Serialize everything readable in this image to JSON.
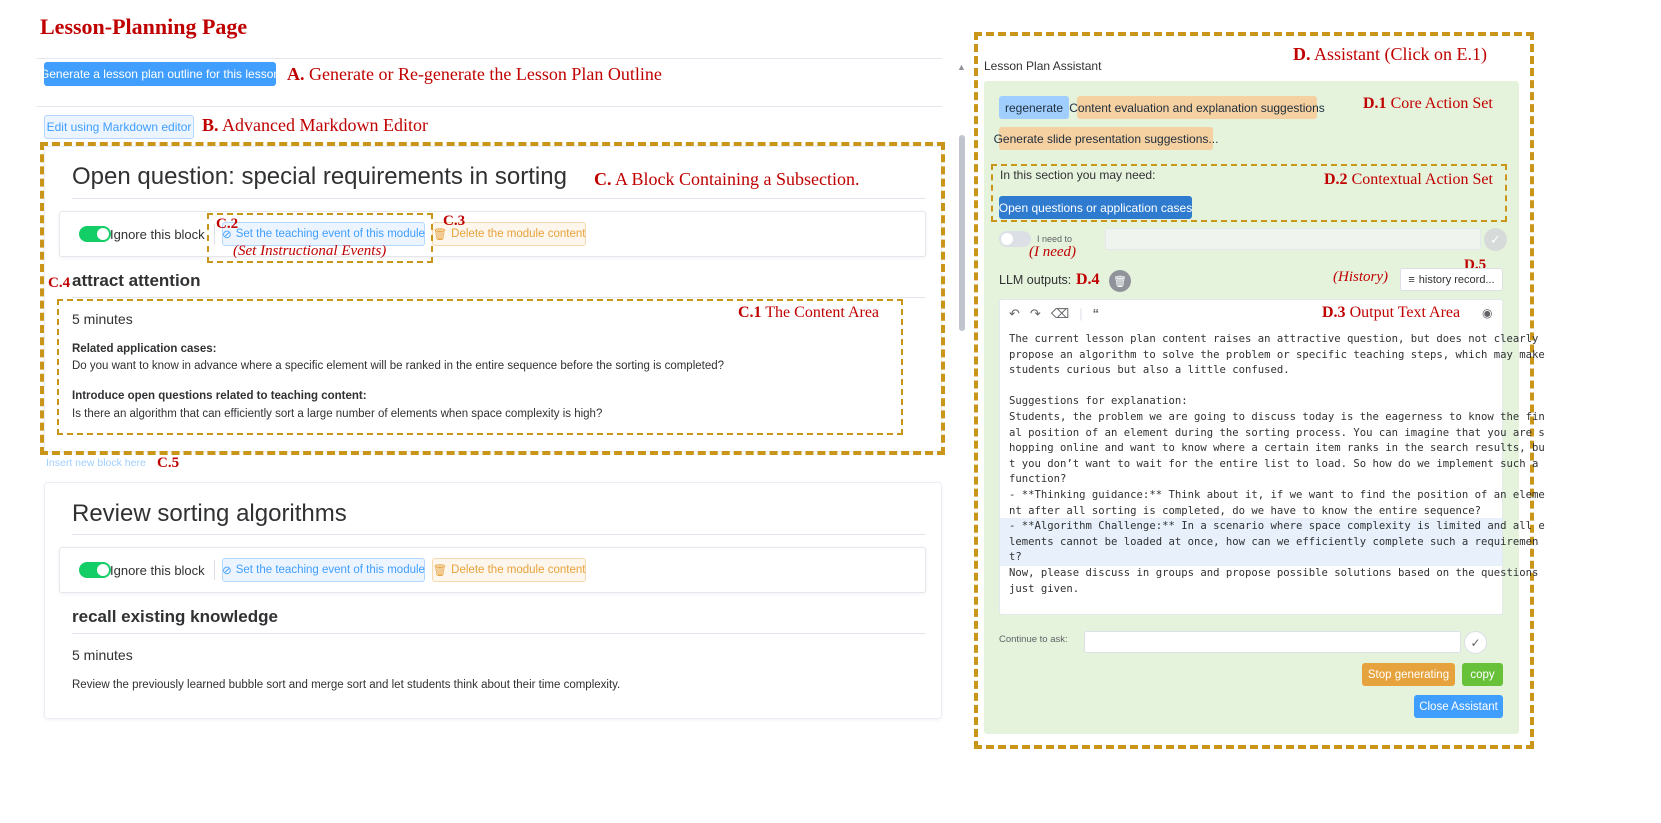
{
  "page_title": "Lesson-Planning Page",
  "colors": {
    "accent": "#409eff",
    "success": "#13ce66",
    "warning": "#e6a23c",
    "annotation": "#c00000",
    "frame": "#c9961a",
    "assistant_bg": "#e5f3dd"
  },
  "annotations": {
    "a_letter": "A.",
    "a_text": "Generate or Re-generate the Lesson Plan Outline",
    "b_letter": "B.",
    "b_text": "Advanced Markdown Editor",
    "c_letter": "C.",
    "c_text": "A Block Containing a Subsection.",
    "c1_letter": "C.1",
    "c1_text": "The Content Area",
    "c2": "C.2",
    "c2_sub": "(Set Instructional Events)",
    "c3": "C.3",
    "c4": "C.4",
    "c5": "C.5",
    "d_letter": "D.",
    "d_text": "Assistant (Click on E.1)",
    "d1_letter": "D.1",
    "d1_text": "Core Action Set",
    "d2_letter": "D.2",
    "d2_text": "Contextual Action Set",
    "d3_letter": "D.3",
    "d3_text": "Output Text Area",
    "d4": "D.4",
    "d5": "D.5",
    "i_need": "(I need)",
    "history": "(History)"
  },
  "toolbar": {
    "generate_outline_label": "Generate a lesson plan outline for this lesson",
    "markdown_editor_label": "Edit using Markdown editor"
  },
  "blocks": [
    {
      "title": "Open question: special requirements in sorting",
      "ignore_label": "Ignore this block",
      "ignore_on": true,
      "set_event_label": "Set the teaching event of this module",
      "delete_label": "Delete the module content",
      "event_heading": "attract attention",
      "duration": "5 minutes",
      "sections": [
        {
          "heading": "Related application cases:",
          "text": "Do you want to know in advance where a specific element will be ranked in the entire sequence before the sorting is completed?"
        },
        {
          "heading": "Introduce open questions related to teaching content:",
          "text": "Is there an algorithm that can efficiently sort a large number of elements when space complexity is high?"
        }
      ]
    },
    {
      "title": "Review sorting algorithms",
      "ignore_label": "Ignore this block",
      "ignore_on": true,
      "set_event_label": "Set the teaching event of this module",
      "delete_label": "Delete the module content",
      "event_heading": "recall existing knowledge",
      "duration": "5 minutes",
      "text": "Review the previously learned bubble sort and merge sort and let students think about their time complexity."
    }
  ],
  "insert_block_label": "Insert new block here",
  "assistant": {
    "title": "Lesson Plan Assistant",
    "core_actions": [
      "regenerate",
      "Content evaluation and explanation suggestions",
      "Generate slide presentation suggestions..."
    ],
    "contextual_hint": "In this section you may need:",
    "contextual_actions": [
      "Open questions or application cases"
    ],
    "i_need_label": "I need to",
    "i_need_value": "",
    "llm_outputs_label": "LLM outputs:",
    "history_button_label": "history record...",
    "output_lines": [
      "The current lesson plan content raises an attractive question, but does not clearly",
      "propose an algorithm to solve the problem or specific teaching steps, which may make",
      "students curious but also a little confused.",
      "",
      "Suggestions for explanation:",
      "Students, the problem we are going to discuss today is the eagerness to know the fin",
      "al position of an element during the sorting process. You can imagine that you are s",
      "hopping online and want to know where a certain item ranks in the search results, bu",
      "t you don’t want to wait for the entire list to load. So how do we implement such a",
      "function?",
      "- **Thinking guidance:** Think about it, if we want to find the position of an eleme",
      "nt after all sorting is completed, do we have to know the entire sequence?",
      "- **Algorithm Challenge:** In a scenario where space complexity is limited and all e",
      "lements cannot be loaded at once, how can we efficiently complete such a requiremen",
      "t?",
      "Now, please discuss in groups and propose possible solutions based on the questions",
      "just given."
    ],
    "continue_label": "Continue to ask:",
    "continue_value": "",
    "stop_label": "Stop generating",
    "copy_label": "copy",
    "close_label": "Close Assistant"
  }
}
